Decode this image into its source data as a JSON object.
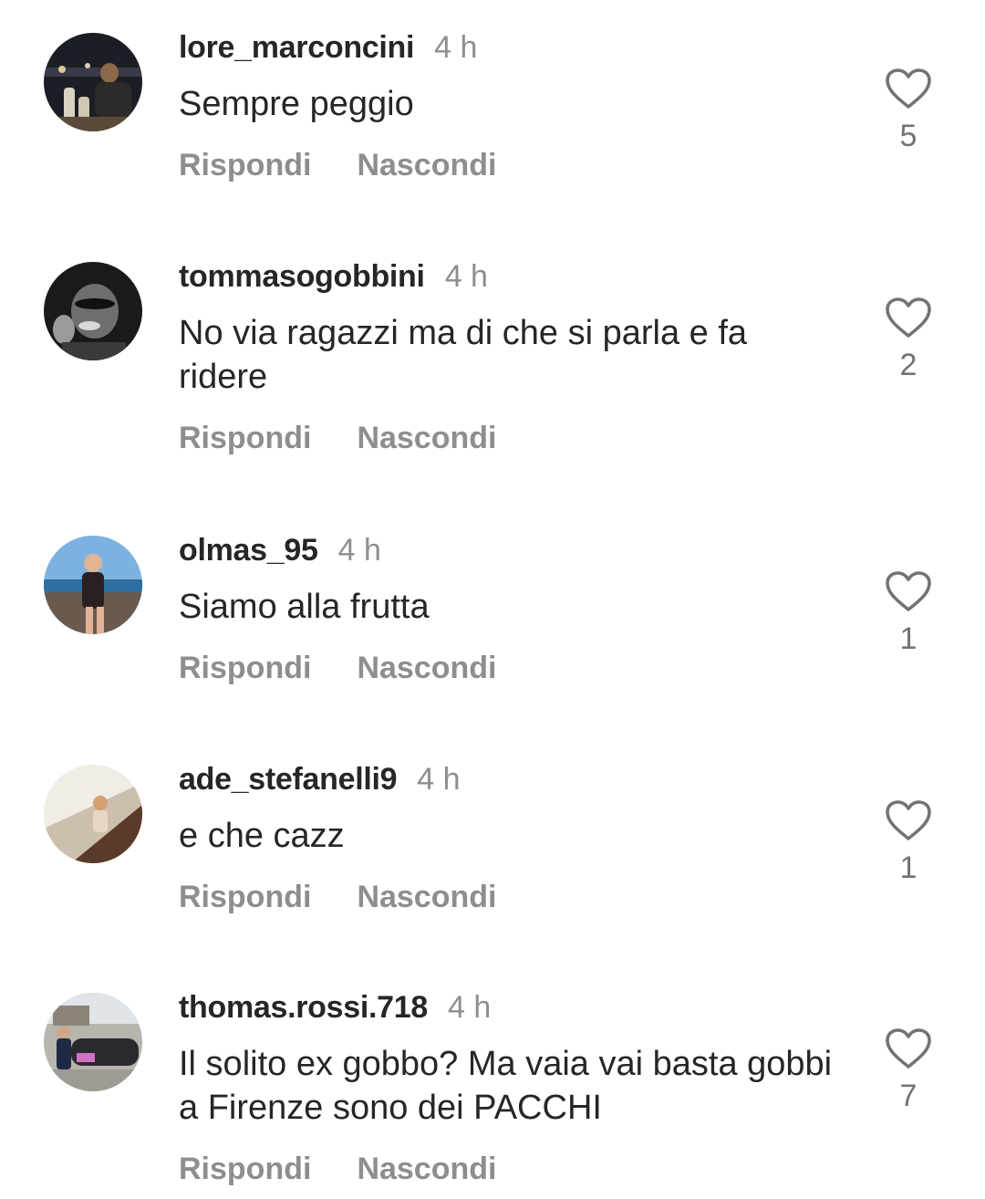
{
  "comments": [
    {
      "username": "lore_marconcini",
      "time": "4 h",
      "text": "Sempre peggio",
      "reply_label": "Rispondi",
      "hide_label": "Nascondi",
      "likes": "5",
      "avatar_colors": [
        "#1c1e26",
        "#8a6a48"
      ]
    },
    {
      "username": "tommasogobbini",
      "time": "4 h",
      "text": "No via ragazzi ma di che si parla e fa ridere",
      "reply_label": "Rispondi",
      "hide_label": "Nascondi",
      "likes": "2",
      "avatar_colors": [
        "#1a1a1a",
        "#9a9a9a"
      ]
    },
    {
      "username": "olmas_95",
      "time": "4 h",
      "text": "Siamo alla frutta",
      "reply_label": "Rispondi",
      "hide_label": "Nascondi",
      "likes": "1",
      "avatar_colors": [
        "#7db2e0",
        "#2f6ea0"
      ]
    },
    {
      "username": "ade_stefanelli9",
      "time": "4 h",
      "text": "e che cazz",
      "reply_label": "Rispondi",
      "hide_label": "Nascondi",
      "likes": "1",
      "avatar_colors": [
        "#f0ece6",
        "#5a3a28"
      ]
    },
    {
      "username": "thomas.rossi.718",
      "time": "4 h",
      "text": "Il solito ex gobbo? Ma vaia vai basta gobbi a Firenze sono dei PACCHI",
      "reply_label": "Rispondi",
      "hide_label": "Nascondi",
      "likes": "7",
      "avatar_colors": [
        "#b8b4ae",
        "#2a2a2e"
      ]
    }
  ]
}
